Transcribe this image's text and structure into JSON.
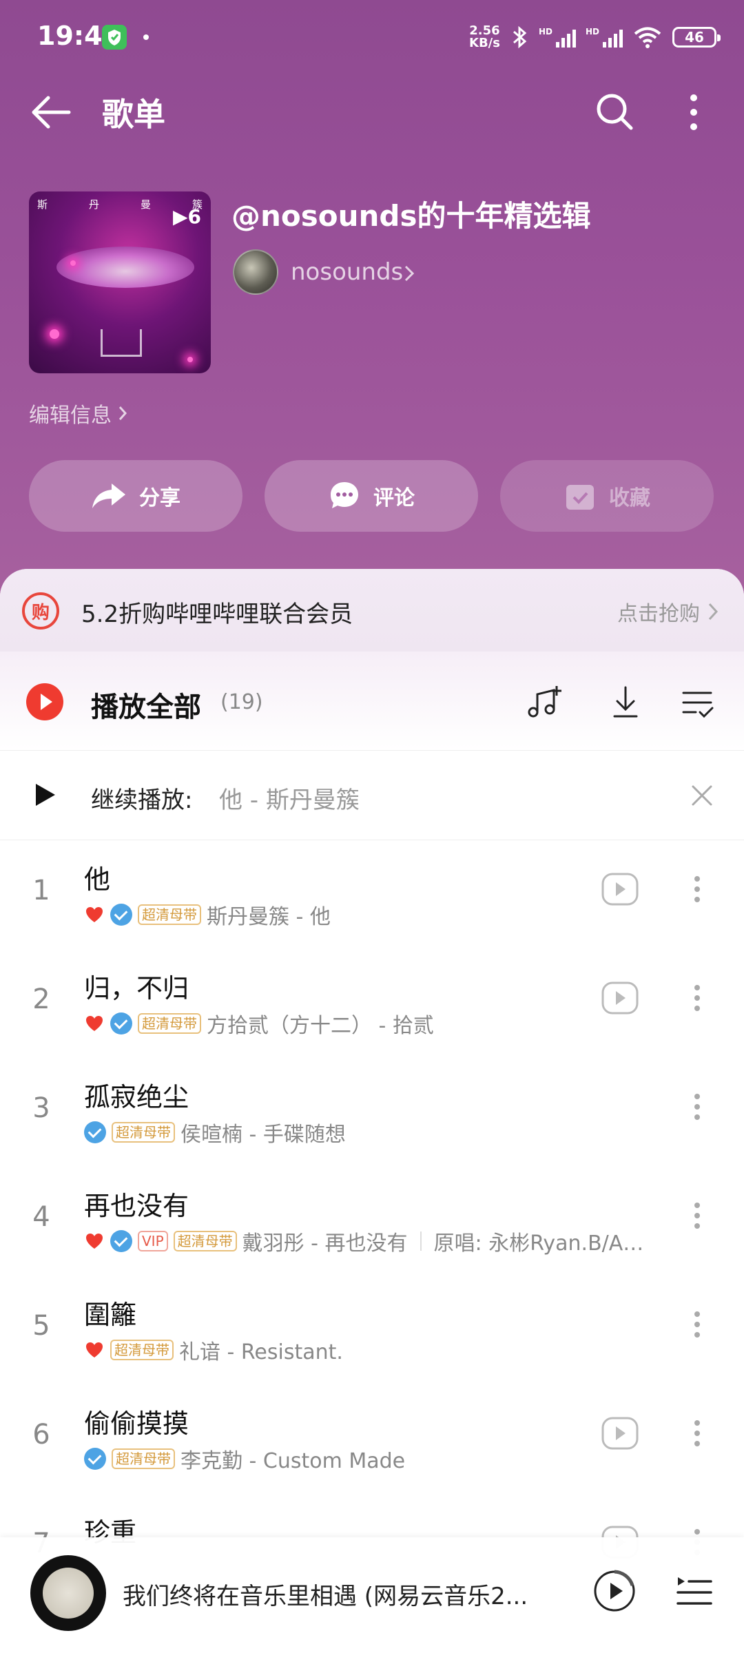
{
  "status_bar": {
    "time": "19:42",
    "speed_top": "2.56",
    "speed_bottom": "KB/s",
    "hd": "HD",
    "battery": "46"
  },
  "header": {
    "title": "歌单"
  },
  "playlist": {
    "title": "@nosounds的十年精选辑",
    "owner": "nosounds",
    "edit_info": "编辑信息",
    "cover_letters": [
      "斯",
      "丹",
      "曼",
      "簇"
    ],
    "cover_play_count": "6"
  },
  "actions": {
    "share": "分享",
    "comment": "评论",
    "collect": "收藏"
  },
  "promo": {
    "icon_text": "购",
    "text": "5.2折购哔哩哔哩联合会员",
    "cta": "点击抢购"
  },
  "play_all": {
    "label": "播放全部",
    "count": "(19)"
  },
  "continue": {
    "label": "继续播放:",
    "song": "他 - 斯丹曼簇"
  },
  "songs": [
    {
      "num": "1",
      "title": "他",
      "liked": true,
      "verified": true,
      "vip": false,
      "hq": "超清母带",
      "meta": "斯丹曼簇 - 他",
      "original": "",
      "has_play": true
    },
    {
      "num": "2",
      "title": "归，不归",
      "liked": true,
      "verified": true,
      "vip": false,
      "hq": "超清母带",
      "meta": "方拾贰（方十二） - 拾贰",
      "original": "",
      "has_play": true
    },
    {
      "num": "3",
      "title": "孤寂绝尘",
      "liked": false,
      "verified": true,
      "vip": false,
      "hq": "超清母带",
      "meta": "侯暄楠 - 手碟随想",
      "original": "",
      "has_play": false
    },
    {
      "num": "4",
      "title": "再也没有",
      "liked": true,
      "verified": true,
      "vip": true,
      "vip_label": "VIP",
      "hq": "超清母带",
      "meta": "戴羽彤 - 再也没有",
      "original": "原唱: 永彬Ryan.B/A…",
      "has_play": false
    },
    {
      "num": "5",
      "title": "圍籬",
      "liked": true,
      "verified": false,
      "vip": false,
      "hq": "超清母带",
      "meta": "礼谙 - Resistant.",
      "original": "",
      "has_play": false
    },
    {
      "num": "6",
      "title": "偷偷摸摸",
      "liked": false,
      "verified": true,
      "vip": false,
      "hq": "超清母带",
      "meta": "李克勤 - Custom Made",
      "original": "",
      "has_play": true
    },
    {
      "num": "7",
      "title": "珍重",
      "liked": false,
      "verified": false,
      "vip": false,
      "hq": "",
      "meta": "",
      "original": "",
      "has_play": true
    }
  ],
  "mini_player": {
    "title": "我们终将在音乐里相遇 (网易云音乐2..."
  },
  "colors": {
    "hero": "#9a5199",
    "accent_red": "#ef3b30",
    "verified_blue": "#4da3e4",
    "hq_gold": "#d49a3c"
  }
}
